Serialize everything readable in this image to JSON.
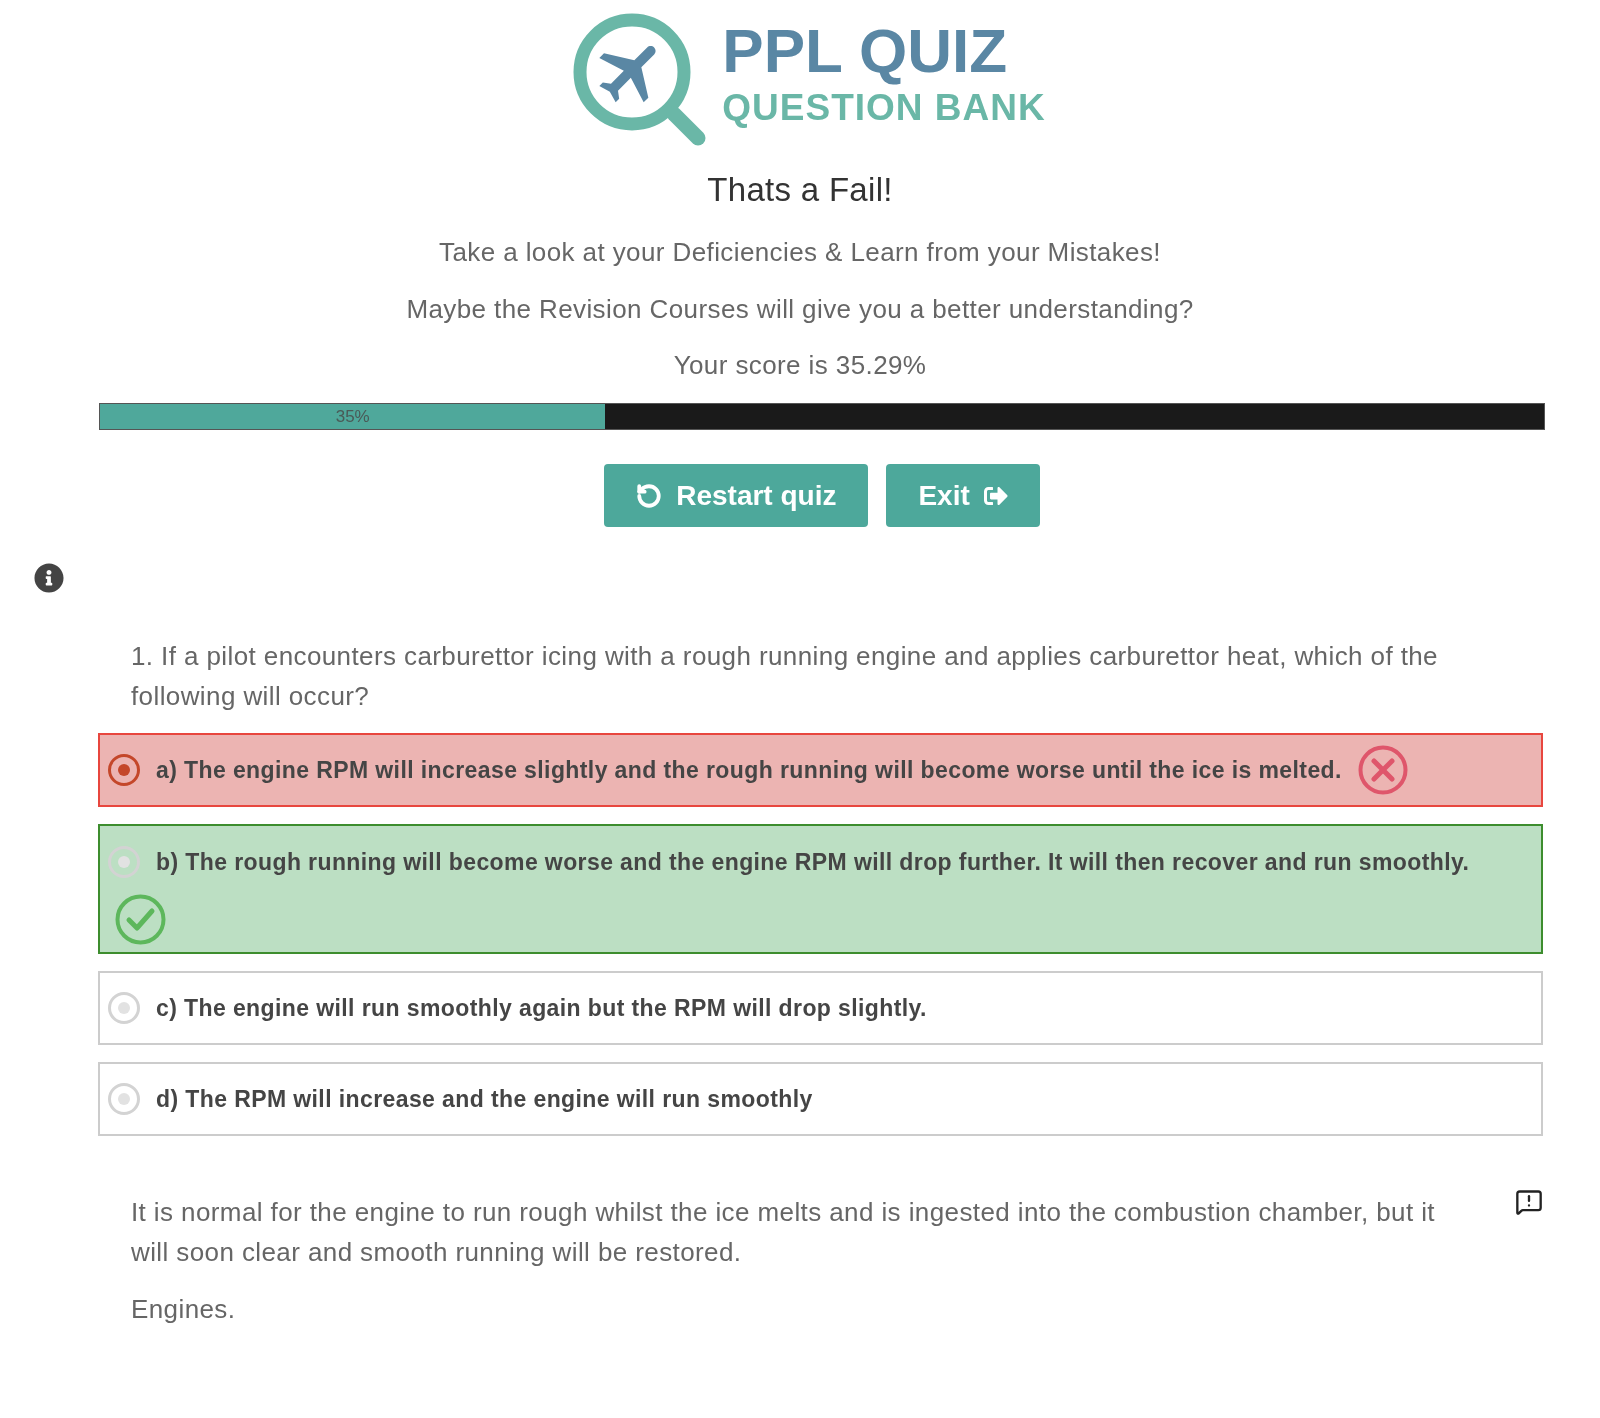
{
  "logo": {
    "title": "PPL QUIZ",
    "subtitle": "QUESTION BANK"
  },
  "result": {
    "heading": "Thats a Fail!",
    "messages": [
      "Take a look at your Deficiencies & Learn from your Mistakes!",
      "Maybe the Revision Courses will give you a better understanding?"
    ],
    "score": "Your score is 35.29%"
  },
  "progress": {
    "level": 0.35,
    "label": "35%"
  },
  "buttons": [
    {
      "kind": "restart",
      "label": "Restart quiz"
    },
    {
      "kind": "exit",
      "label": "Exit"
    }
  ],
  "question": {
    "text": "1. If a pilot encounters carburettor icing with a rough running engine and applies carburettor heat, which of the following will occur?",
    "answers": [
      {
        "kind": "wrong",
        "selected": true,
        "label": "a) The engine RPM will increase slightly and the rough running will become worse until the ice is melted."
      },
      {
        "kind": "correct",
        "selected": false,
        "label": "b) The rough running will become worse and the engine RPM will drop further. It will then recover and run smoothly."
      },
      {
        "kind": "plain",
        "selected": false,
        "label": "c) The engine will run smoothly again but the RPM will drop slightly."
      },
      {
        "kind": "plain",
        "selected": false,
        "label": "d) The RPM will increase and the engine will run smoothly"
      }
    ]
  },
  "explanation": {
    "paragraphs": [
      "It is normal for the engine to run rough whilst the ice melts and is ingested into the combustion chamber, but it will soon clear and smooth running will be restored.",
      "Engines."
    ]
  }
}
